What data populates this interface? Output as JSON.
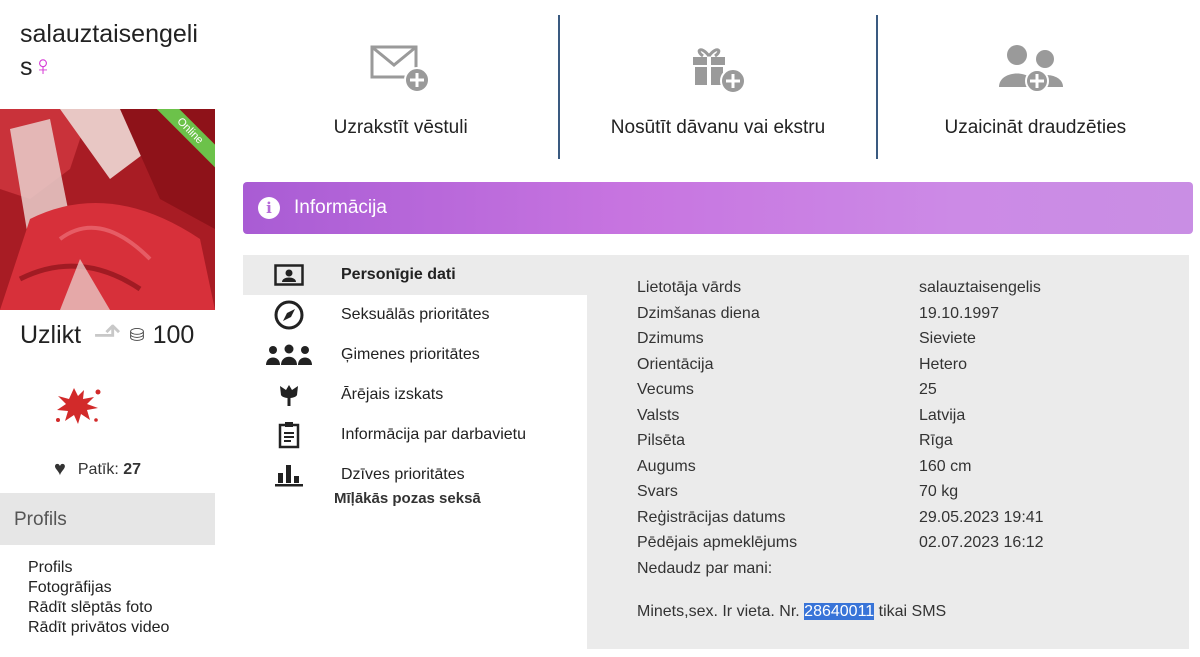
{
  "profile": {
    "username": "salauztaisengelis",
    "gender_symbol": "♀",
    "online_label": "Online",
    "uzlikt_label": "Uzlikt",
    "coins": "100",
    "likes_label": "Patīk:",
    "likes_count": "27"
  },
  "sidebar": {
    "heading": "Profils",
    "links": [
      "Profils",
      "Fotogrāfijas",
      "Rādīt slēptās foto",
      "Rādīt privātos video"
    ]
  },
  "actions": [
    {
      "label": "Uzrakstīt vēstuli",
      "icon": "envelope-plus-icon"
    },
    {
      "label": "Nosūtīt dāvanu vai ekstru",
      "icon": "gift-plus-icon"
    },
    {
      "label": "Uzaicināt draudzēties",
      "icon": "users-plus-icon"
    }
  ],
  "info_bar": {
    "title": "Informācija"
  },
  "menu": {
    "items": [
      {
        "label": "Personīgie dati",
        "icon": "id-card-icon",
        "active": true
      },
      {
        "label": "Seksuālās prioritātes",
        "icon": "compass-icon"
      },
      {
        "label": "Ģimenes prioritātes",
        "icon": "family-icon"
      },
      {
        "label": "Ārējais izskats",
        "icon": "tulip-icon"
      },
      {
        "label": "Informācija par darbavietu",
        "icon": "clipboard-icon"
      },
      {
        "label": "Dzīves prioritātes",
        "icon": "bar-chart-icon"
      }
    ],
    "sub": "Mīļākās pozas seksā"
  },
  "details": [
    {
      "key": "Lietotāja vārds",
      "value": "salauztaisengelis"
    },
    {
      "key": "Dzimšanas diena",
      "value": "19.10.1997"
    },
    {
      "key": "Dzimums",
      "value": "Sieviete"
    },
    {
      "key": "Orientācija",
      "value": "Hetero"
    },
    {
      "key": "Vecums",
      "value": "25"
    },
    {
      "key": "Valsts",
      "value": "Latvija"
    },
    {
      "key": "Pilsēta",
      "value": "Rīga"
    },
    {
      "key": "Augums",
      "value": "160 cm"
    },
    {
      "key": "Svars",
      "value": "70 kg"
    },
    {
      "key": "Reģistrācijas datums",
      "value": "29.05.2023 19:41"
    },
    {
      "key": "Pēdējais apmeklējums",
      "value": "02.07.2023 16:12"
    },
    {
      "key": "Nedaudz par mani:",
      "value": ""
    }
  ],
  "about": {
    "before": "Minets,sex. Ir vieta. Nr.",
    "highlight": "28640011",
    "after": "tikai SMS"
  },
  "colors": {
    "accent": "#b56ad8",
    "divider": "#3a5a80",
    "online": "#6cc24a",
    "panel": "#ebebeb"
  }
}
